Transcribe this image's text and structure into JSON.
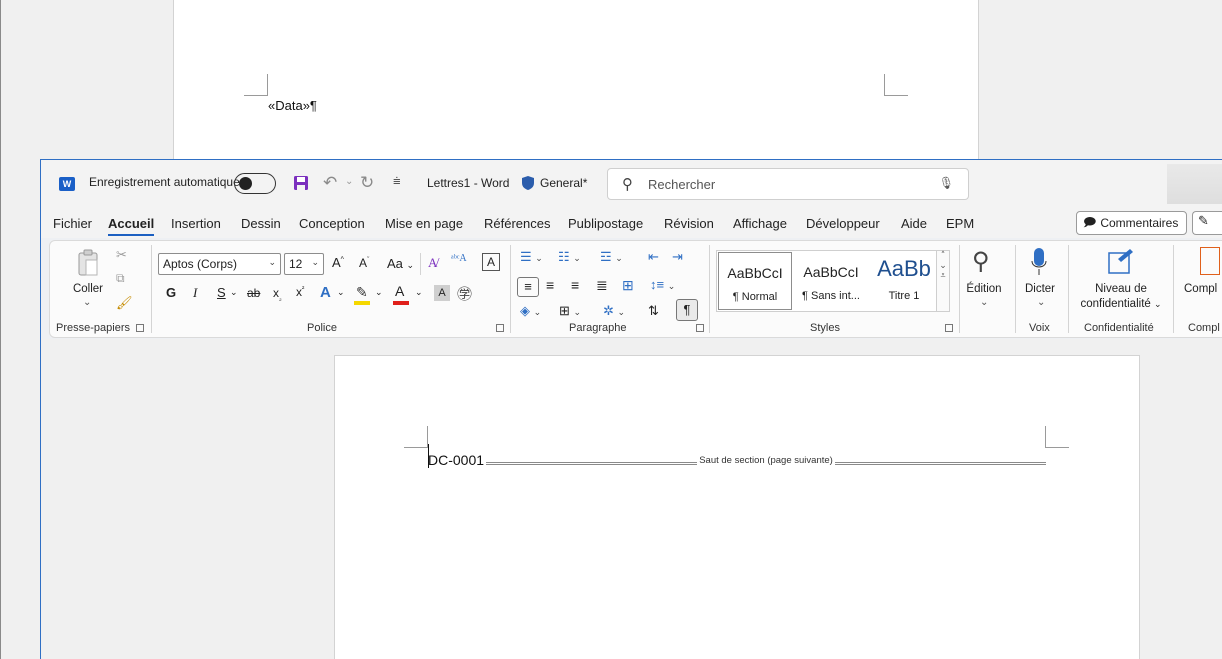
{
  "background_window": {
    "merge_field": "«Data»¶"
  },
  "titlebar": {
    "app_logo": "W",
    "autosave_label": "Enregistrement automatique",
    "doc_title": "Lettres1 - Word",
    "sensitivity_label": "General*",
    "search_placeholder": "Rechercher"
  },
  "tabs": [
    "Fichier",
    "Accueil",
    "Insertion",
    "Dessin",
    "Conception",
    "Mise en page",
    "Références",
    "Publipostage",
    "Révision",
    "Affichage",
    "Développeur",
    "Aide",
    "EPM"
  ],
  "active_tab": "Accueil",
  "actions": {
    "comments_label": "Commentaires"
  },
  "ribbon": {
    "clipboard": {
      "paste_label": "Coller",
      "group_label": "Presse-papiers"
    },
    "font": {
      "font_name": "Aptos (Corps)",
      "font_size": "12",
      "case_label": "Aa",
      "bold": "G",
      "italic": "I",
      "underline": "S",
      "strike": "ab",
      "group_label": "Police"
    },
    "paragraph": {
      "group_label": "Paragraphe"
    },
    "styles": {
      "items": [
        {
          "preview": "AaBbCcI",
          "name": "¶ Normal"
        },
        {
          "preview": "AaBbCcI",
          "name": "¶ Sans int..."
        },
        {
          "preview": "AaBb",
          "name": "Titre 1"
        }
      ],
      "group_label": "Styles"
    },
    "editing": {
      "label": "Édition"
    },
    "voice": {
      "dictate_label": "Dicter",
      "group_label": "Voix"
    },
    "privacy": {
      "label_line1": "Niveau de",
      "label_line2": "confidentialité",
      "group_label": "Confidentialité"
    },
    "addins": {
      "label": "Compl",
      "group_label": "Compl"
    }
  },
  "document": {
    "text": "DC-0001",
    "section_break": "Saut de section (page suivante)"
  },
  "colors": {
    "accent": "#1b5fc1",
    "word_blue": "#1a5fc7",
    "highlight": "#f5d800",
    "font_red": "#e0201b"
  }
}
